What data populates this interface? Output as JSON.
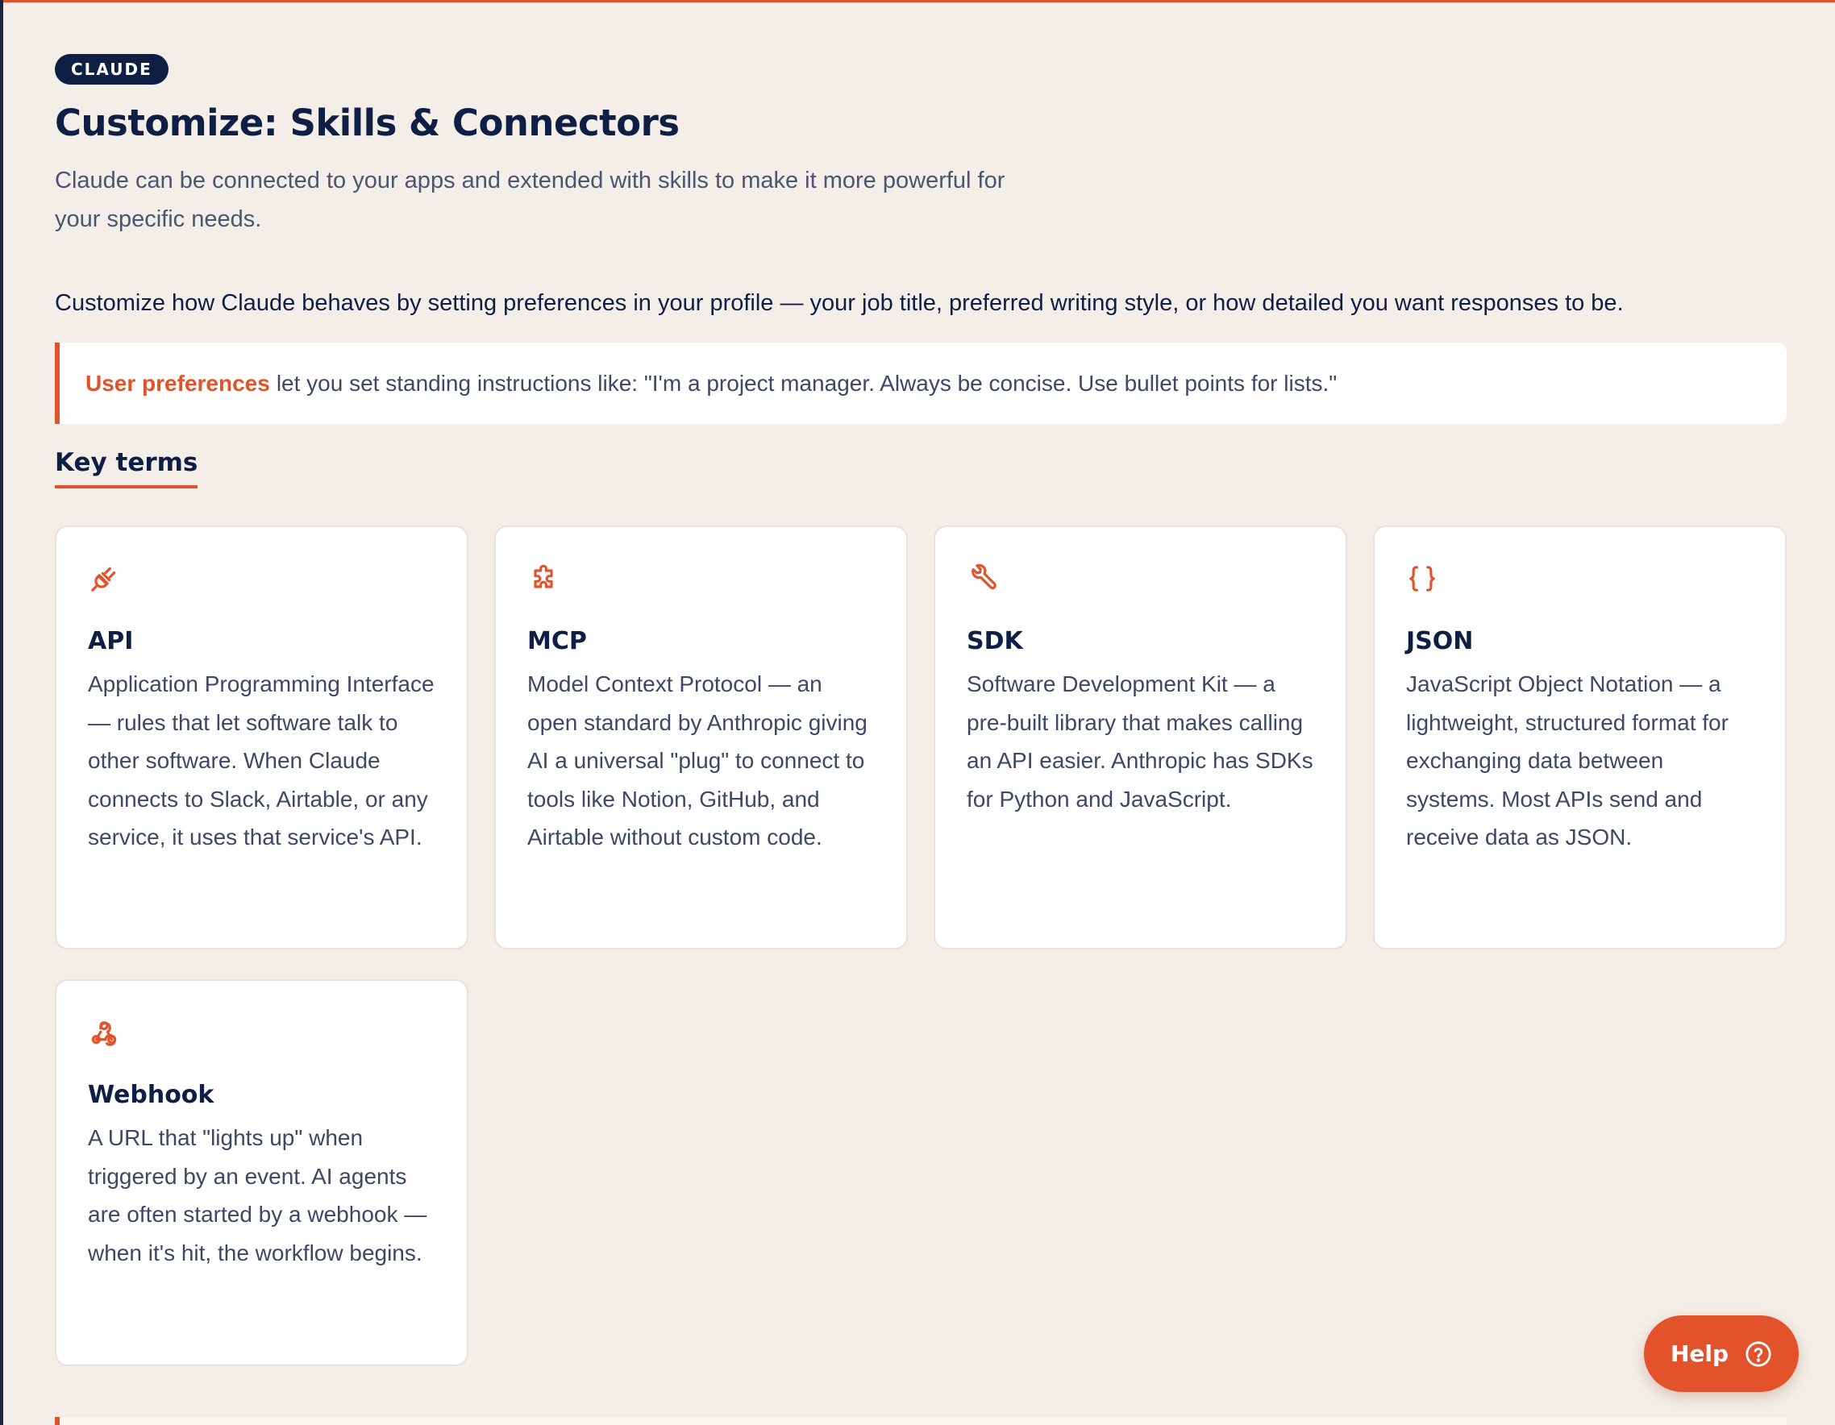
{
  "badge": "CLAUDE",
  "title": "Customize: Skills & Connectors",
  "subtitle": "Claude can be connected to your apps and extended with skills to make it more powerful for your specific needs.",
  "intro": "Customize how Claude behaves by setting preferences in your profile — your job title, preferred writing style, or how detailed you want responses to be.",
  "callout": {
    "highlight": "User preferences",
    "text": "let you set standing instructions like: \"I'm a project manager. Always be concise. Use bullet points for lists.\""
  },
  "section_title": "Key terms",
  "terms": [
    {
      "icon": "plug-icon",
      "title": "API",
      "description": "Application Programming Interface — rules that let software talk to other software. When Claude connects to Slack, Airtable, or any service, it uses that service's API."
    },
    {
      "icon": "puzzle-icon",
      "title": "MCP",
      "description": "Model Context Protocol — an open standard by Anthropic giving AI a universal \"plug\" to connect to tools like Notion, GitHub, and Airtable without custom code."
    },
    {
      "icon": "wrench-icon",
      "title": "SDK",
      "description": "Software Development Kit — a pre-built library that makes calling an API easier. Anthropic has SDKs for Python and JavaScript."
    },
    {
      "icon": "braces-icon",
      "title": "JSON",
      "description": "JavaScript Object Notation — a lightweight, structured format for exchanging data between systems. Most APIs send and receive data as JSON."
    },
    {
      "icon": "webhook-icon",
      "title": "Webhook",
      "description": "A URL that \"lights up\" when triggered by an event. AI agents are often started by a webhook — when it's hit, the workflow begins."
    }
  ],
  "help_button": {
    "label": "Help",
    "icon": "question-circle-icon"
  },
  "colors": {
    "accent": "#e2522b",
    "navy": "#0f1e45",
    "background": "#f3efe8",
    "card": "#ffffff"
  }
}
